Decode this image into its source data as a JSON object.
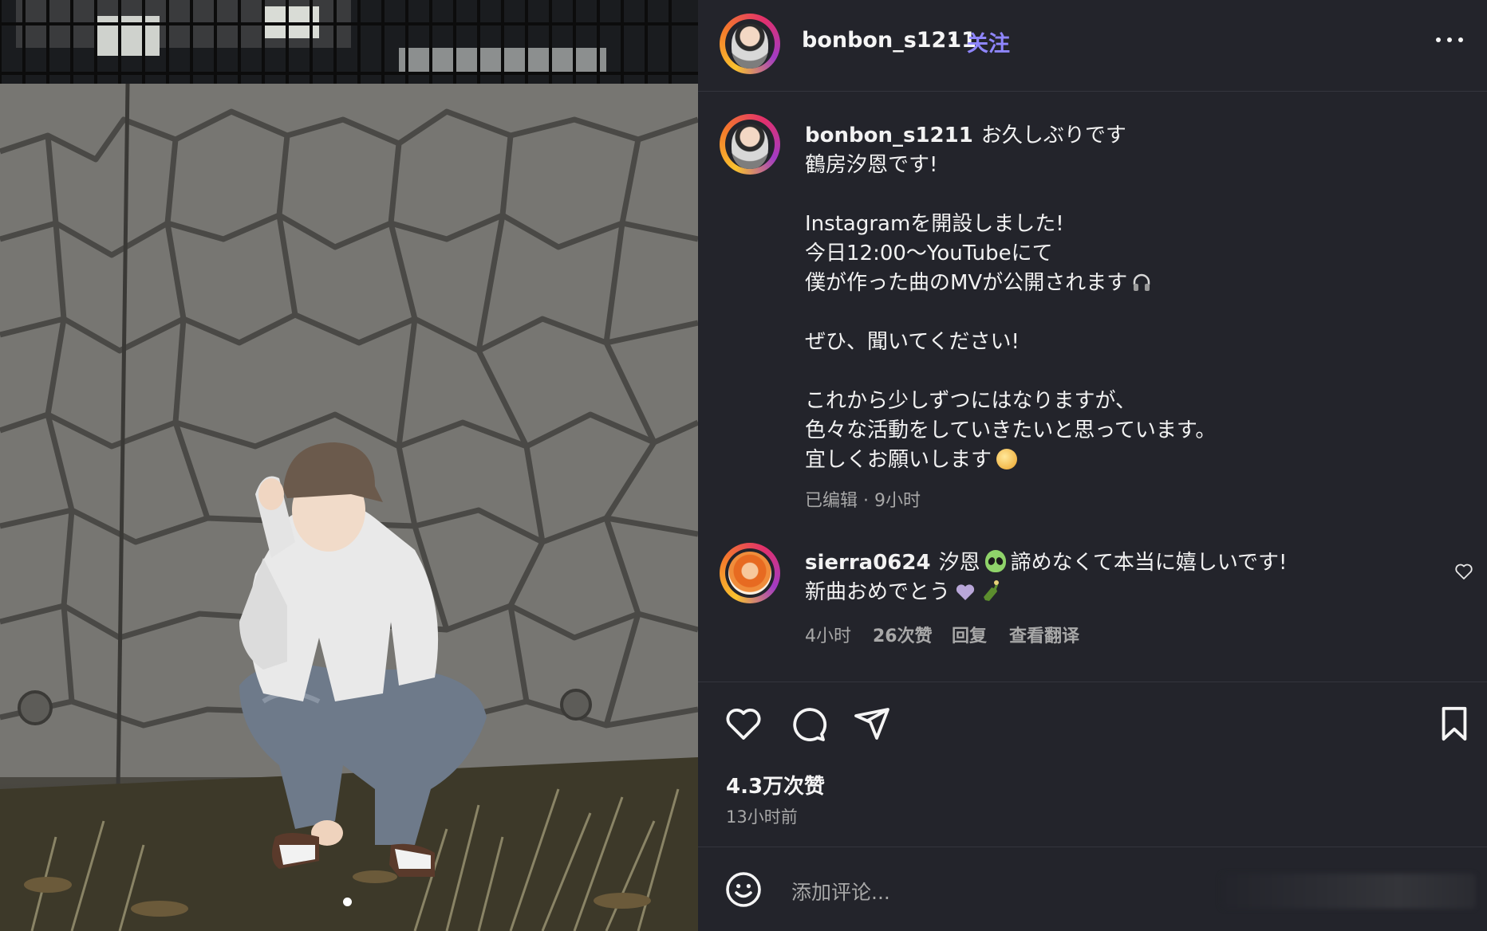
{
  "post": {
    "username": "bonbon_s1211",
    "separator": "•",
    "follow_label": "关注",
    "caption_lines": [
      "お久しぶりです",
      "鶴房汐恩です!",
      "",
      "Instagramを開設しました!",
      "今日12:00〜YouTubeにて",
      "僕が作った曲のMVが公開されます",
      "",
      "ぜひ、聞いてください!",
      "",
      "これから少しずつにはなりますが、",
      "色々な活動をしていきたいと思っています。",
      "宜しくお願いします"
    ],
    "caption_meta": "已编辑 · 9小时",
    "likes": "4.3万次赞",
    "time_ago": "13小时前",
    "carousel_index": 1
  },
  "comment": {
    "username": "sierra0624",
    "text_line1_a": "汐恩",
    "text_line1_b": "諦めなくて本当に嬉しいです!",
    "text_line2": "新曲おめでとう",
    "time": "4小时",
    "likes": "26次赞",
    "reply_label": "回复",
    "translate_label": "查看翻译"
  },
  "composer": {
    "placeholder": "添加评论..."
  },
  "icons": {
    "more": "more-horizontal-icon",
    "like": "heart-icon",
    "comment": "comment-bubble-icon",
    "share": "send-icon",
    "save": "bookmark-icon",
    "emoji": "smile-icon"
  },
  "colors": {
    "background": "#23242b",
    "accent_follow": "#8f86ff",
    "meta_text": "#a8a8a8"
  }
}
